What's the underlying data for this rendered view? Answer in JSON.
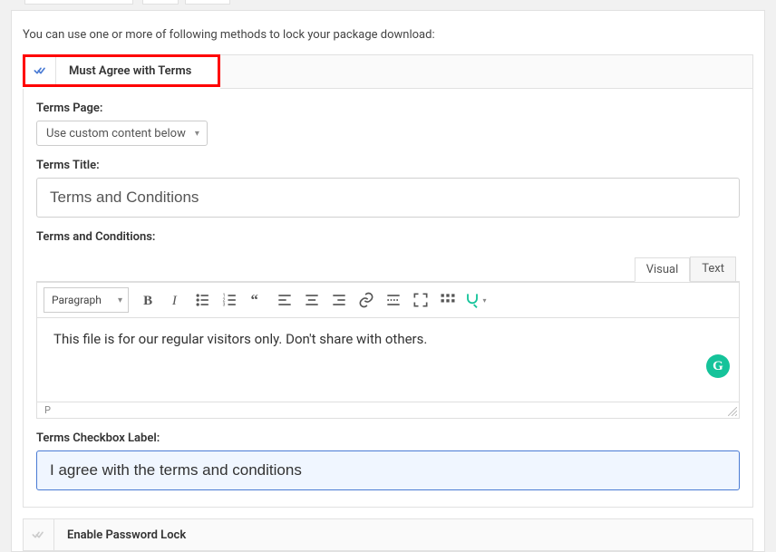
{
  "intro": "You can use one or more of following methods to lock your package download:",
  "sections": {
    "terms": {
      "title": "Must Agree with Terms",
      "terms_page_label": "Terms Page:",
      "terms_page_select": "Use custom content below",
      "terms_title_label": "Terms Title:",
      "terms_title_value": "Terms and Conditions",
      "terms_conditions_label": "Terms and Conditions:",
      "editor": {
        "tab_visual": "Visual",
        "tab_text": "Text",
        "format_select": "Paragraph",
        "content": "This file is for our regular visitors only. Don't share with others.",
        "status_path": "P"
      },
      "checkbox_label_label": "Terms Checkbox Label:",
      "checkbox_label_value": "I agree with the terms and conditions"
    },
    "password": {
      "title": "Enable Password Lock"
    }
  }
}
